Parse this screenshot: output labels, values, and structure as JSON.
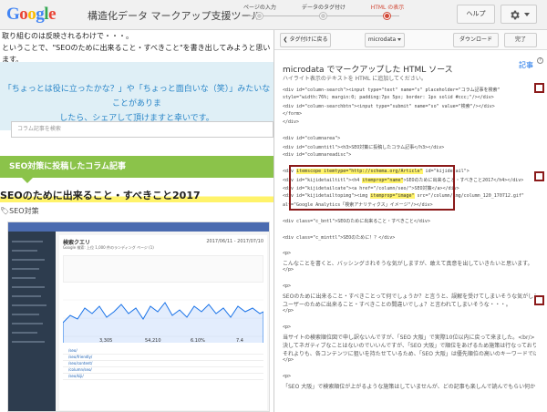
{
  "header": {
    "logo_letters": [
      {
        "char": "G",
        "color": "#4285f4"
      },
      {
        "char": "o",
        "color": "#ea4335"
      },
      {
        "char": "o",
        "color": "#fbbc05"
      },
      {
        "char": "g",
        "color": "#4285f4"
      },
      {
        "char": "l",
        "color": "#34a853"
      },
      {
        "char": "e",
        "color": "#ea4335"
      }
    ],
    "app_title": "構造化データ マークアップ支援ツール",
    "steps": [
      {
        "label": "ページの入力",
        "active": false
      },
      {
        "label": "データのタグ付け",
        "active": false
      },
      {
        "label": "HTML の表示",
        "active": true
      }
    ],
    "help_label": "ヘルプ",
    "settings_icon": "gear-icon"
  },
  "preview": {
    "intro_line1": "取り組むのは反映されるわけで・・・。",
    "intro_line2": "ということで、\"SEOのために出来ること・すべきこと\"を書き出してみようと思います。",
    "banner_line1": "「ちょっとは役に立ったかな？」や「ちょっと面白いな（笑）」みたいなことがありま",
    "banner_line2": "したら、シェアして頂けますと幸いです。",
    "search_placeholder": "コラム記事を検索",
    "category_heading": "SEO対策に投稿したコラム記事",
    "article_title": "SEOのために出来ること・すべきこと2017",
    "article_tag": "SEO対策",
    "thumbnail": {
      "title": "検索クエリ",
      "subtitle": "Google 検索: 上位 1,000 件のランディング ページ (1)",
      "date": "2017/06/11 - 2017/07/10",
      "totals": [
        "3,305",
        "54,210",
        "6.10%",
        "7.4"
      ],
      "rows": [
        "/seo/",
        "/seo/friendly/",
        "/seo/content/",
        "/column/seo/",
        "/seo/kiji/"
      ]
    }
  },
  "code_panel": {
    "back_label": "タグ付けに戻る",
    "format_label": "microdata",
    "download_label": "ダウンロード",
    "done_label": "完了",
    "title": "microdata でマークアップした HTML ソース",
    "subtitle": "ハイライト表示のテキストを HTML に追加してください。",
    "kiji_label": "記事",
    "help_icon": "?",
    "lines": [
      {
        "text": "<div id=\"column-search\"><input type=\"text\" name=\"s\" placeholder=\"コラム記事を検索\"",
        "jp": false
      },
      {
        "text": "style=\"width:76%; margin:0; padding:7px 5px; border: 1px solid #ccc;\"/></div>",
        "jp": false
      },
      {
        "text": "<div id=\"column-searchbtn\"><input type=\"submit\" name=\"so\" value=\"検索\"/></div>",
        "jp": false
      },
      {
        "text": "</form>",
        "jp": false
      },
      {
        "text": "</div>",
        "jp": false
      },
      {
        "text": "",
        "jp": false
      },
      {
        "text": "<div id=\"columnarea\">",
        "jp": false
      },
      {
        "text": "<div id=\"columntitl\"><h3>SEO対策に投稿したコラム記事</h3></div>",
        "jp": false
      },
      {
        "text": "<div id=\"columnareadisc\">",
        "jp": false
      },
      {
        "text": "",
        "jp": false
      },
      {
        "text": "<div itemscope itemtype=\"http://schema.org/Article\" id=\"kijidetail\">",
        "jp": false
      },
      {
        "text": "<div id=\"kijidetailtitl\"><h4 itemprop=\"name\">SEOのために出来ること・すべきこと2017</h4></div>",
        "jp": false
      },
      {
        "text": "<div id=\"kijidetailcate\"><a href=\"/column/seo/\">SEO対策</a></div>",
        "jp": false
      },
      {
        "text": "<div id=\"kijidetailtopimg\"><img itemprop=\"image\" src=\"/column/img/column_120_170712.gif\"",
        "jp": false
      },
      {
        "text": "alt=\"Google Analytics「検索アナリティクス」イメージ\"/></div>",
        "jp": false
      },
      {
        "text": "",
        "jp": false
      },
      {
        "text": "<div class=\"c_bntl\">SEOのために出来ること・すべきこと</div>",
        "jp": false
      },
      {
        "text": "",
        "jp": false
      },
      {
        "text": "<div class=\"c_minttl\">SEOのために！？</div>",
        "jp": false
      },
      {
        "text": "",
        "jp": false
      },
      {
        "text": "<p>",
        "jp": false
      },
      {
        "text": "こんなことを書くと、バッシングされそうな気がしますが、敢えて真意を出していきたいと思います。",
        "jp": true
      },
      {
        "text": "</p>",
        "jp": false
      },
      {
        "text": "",
        "jp": false
      },
      {
        "text": "<p>",
        "jp": false
      },
      {
        "text": "SEOのために出来ること・すべきことって何でしょうか？と言うと、誤解を受けてしまいそうな気がします。<br/>",
        "jp": true
      },
      {
        "text": "ユーザーのために出来ること・すべきことの間違いでしょ？と言われてしまいそうな・・・。",
        "jp": true
      },
      {
        "text": "</p>",
        "jp": false
      },
      {
        "text": "",
        "jp": false
      },
      {
        "text": "<p>",
        "jp": false
      },
      {
        "text": "当サイトの検索順位図で申し訳ないんですが、「SEO 大阪」で実際10位以内に戻って来ました。<br/>",
        "jp": true
      },
      {
        "text": "決してネガティブなことはないのでいいんですが、「SEO 大阪」で順位をあげるため施策は行なっておりません。<br/>",
        "jp": true
      },
      {
        "text": "それよりも、各コンテンツに狙いを持たせているため、「SEO 大阪」は優先順位の高いのキーワードではありません。",
        "jp": true
      },
      {
        "text": "</p>",
        "jp": false
      },
      {
        "text": "",
        "jp": false
      },
      {
        "text": "<p>",
        "jp": false
      },
      {
        "text": "「SEO 大阪」で検索順位が上がるような施策はしていませんが、どの記事も楽しんで読んでもらい何かしら",
        "jp": true
      }
    ]
  }
}
